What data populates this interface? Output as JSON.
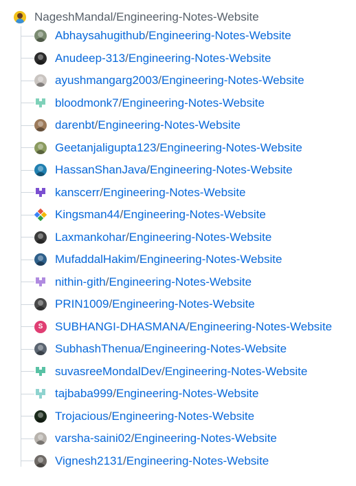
{
  "root": {
    "owner": "NageshMandal",
    "separator": " / ",
    "repo": "Engineering-Notes-Website"
  },
  "forks": [
    {
      "owner": "Abhaysahugithub",
      "repo": "Engineering-Notes-Website",
      "avatar_style": "photo",
      "avatar_color": "#7a8a70"
    },
    {
      "owner": "Anudeep-313",
      "repo": "Engineering-Notes-Website",
      "avatar_style": "photo",
      "avatar_color": "#2b2b2b"
    },
    {
      "owner": "ayushmangarg2003",
      "repo": "Engineering-Notes-Website",
      "avatar_style": "photo",
      "avatar_color": "#c9c4c0"
    },
    {
      "owner": "bloodmonk7",
      "repo": "Engineering-Notes-Website",
      "avatar_style": "identicon",
      "avatar_color": "#7fd1b9"
    },
    {
      "owner": "darenbt",
      "repo": "Engineering-Notes-Website",
      "avatar_style": "photo",
      "avatar_color": "#9c7a5a"
    },
    {
      "owner": "Geetanjaligupta123",
      "repo": "Engineering-Notes-Website",
      "avatar_style": "photo",
      "avatar_color": "#8a9a5e"
    },
    {
      "owner": "HassanShanJava",
      "repo": "Engineering-Notes-Website",
      "avatar_style": "photo",
      "avatar_color": "#1f7fb0"
    },
    {
      "owner": "kanscerr",
      "repo": "Engineering-Notes-Website",
      "avatar_style": "identicon",
      "avatar_color": "#7b4fd1"
    },
    {
      "owner": "Kingsman44",
      "repo": "Engineering-Notes-Website",
      "avatar_style": "diamond",
      "avatar_color": "#e5533d"
    },
    {
      "owner": "Laxmankohar",
      "repo": "Engineering-Notes-Website",
      "avatar_style": "photo",
      "avatar_color": "#3b3b3b"
    },
    {
      "owner": "MufaddalHakim",
      "repo": "Engineering-Notes-Website",
      "avatar_style": "photo",
      "avatar_color": "#2d5f8a"
    },
    {
      "owner": "nithin-gith",
      "repo": "Engineering-Notes-Website",
      "avatar_style": "identicon",
      "avatar_color": "#b08be0"
    },
    {
      "owner": "PRIN1009",
      "repo": "Engineering-Notes-Website",
      "avatar_style": "photo",
      "avatar_color": "#4a4a4a"
    },
    {
      "owner": "SUBHANGI-DHASMANA",
      "repo": "Engineering-Notes-Website",
      "avatar_style": "letter",
      "avatar_letter": "S",
      "avatar_color": "#e03e73"
    },
    {
      "owner": "SubhashThenua",
      "repo": "Engineering-Notes-Website",
      "avatar_style": "photo",
      "avatar_color": "#5a6470"
    },
    {
      "owner": "suvasreeMondalDev",
      "repo": "Engineering-Notes-Website",
      "avatar_style": "identicon",
      "avatar_color": "#59c2a5"
    },
    {
      "owner": "tajbaba999",
      "repo": "Engineering-Notes-Website",
      "avatar_style": "identicon",
      "avatar_color": "#8fd3cf"
    },
    {
      "owner": "Trojacious",
      "repo": "Engineering-Notes-Website",
      "avatar_style": "photo",
      "avatar_color": "#1b2a1b"
    },
    {
      "owner": "varsha-saini02",
      "repo": "Engineering-Notes-Website",
      "avatar_style": "photo",
      "avatar_color": "#b7b2ac"
    },
    {
      "owner": "Vignesh2131",
      "repo": "Engineering-Notes-Website",
      "avatar_style": "photo",
      "avatar_color": "#6f6a66"
    }
  ]
}
